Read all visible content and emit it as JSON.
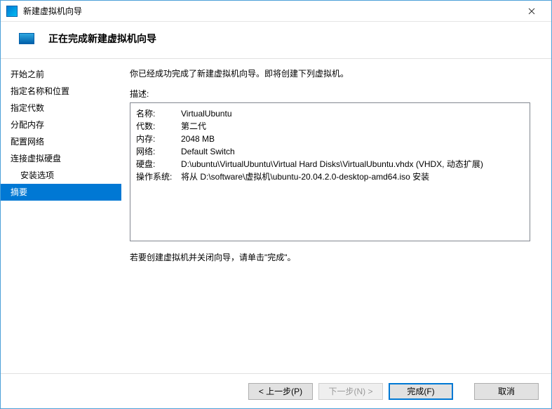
{
  "titlebar": {
    "title": "新建虚拟机向导"
  },
  "header": {
    "title": "正在完成新建虚拟机向导"
  },
  "sidebar": {
    "items": [
      {
        "label": "开始之前",
        "indent": false
      },
      {
        "label": "指定名称和位置",
        "indent": false
      },
      {
        "label": "指定代数",
        "indent": false
      },
      {
        "label": "分配内存",
        "indent": false
      },
      {
        "label": "配置网络",
        "indent": false
      },
      {
        "label": "连接虚拟硬盘",
        "indent": false
      },
      {
        "label": "安装选项",
        "indent": true
      },
      {
        "label": "摘要",
        "indent": false,
        "selected": true
      }
    ]
  },
  "content": {
    "intro": "你已经成功完成了新建虚拟机向导。即将创建下列虚拟机。",
    "desc_label": "描述:",
    "rows": [
      {
        "key": "名称:",
        "val": "VirtualUbuntu"
      },
      {
        "key": "代数:",
        "val": "第二代"
      },
      {
        "key": "内存:",
        "val": "2048 MB"
      },
      {
        "key": "网络:",
        "val": "Default Switch"
      },
      {
        "key": "硬盘:",
        "val": "D:\\ubuntu\\VirtualUbuntu\\Virtual Hard Disks\\VirtualUbuntu.vhdx (VHDX, 动态扩展)"
      },
      {
        "key": "操作系统:",
        "val": "将从 D:\\software\\虚拟机\\ubuntu-20.04.2.0-desktop-amd64.iso 安装"
      }
    ],
    "hint": "若要创建虚拟机并关闭向导，请单击\"完成\"。"
  },
  "footer": {
    "prev": "< 上一步(P)",
    "next": "下一步(N) >",
    "finish": "完成(F)",
    "cancel": "取消"
  }
}
